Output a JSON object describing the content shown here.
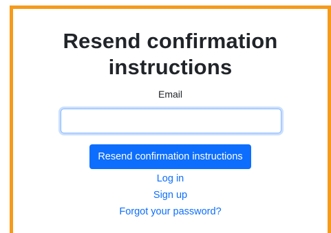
{
  "page": {
    "title": "Resend confirmation instructions",
    "border_color": "#F59B1B"
  },
  "form": {
    "email_label": "Email",
    "email_value": "",
    "submit_label": "Resend confirmation instructions",
    "submit_color": "#0d6efd"
  },
  "links": {
    "log_in": "Log in",
    "sign_up": "Sign up",
    "forgot_password": "Forgot your password?",
    "link_color": "#0d6efd"
  }
}
